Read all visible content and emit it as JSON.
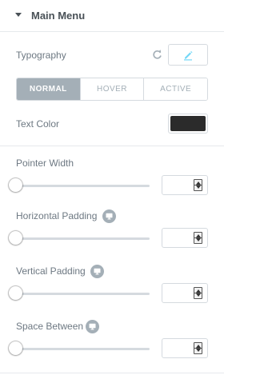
{
  "section": {
    "title": "Main Menu",
    "expanded": true
  },
  "typography": {
    "label": "Typography"
  },
  "tabs": [
    {
      "label": "NORMAL",
      "active": true
    },
    {
      "label": "HOVER",
      "active": false
    },
    {
      "label": "ACTIVE",
      "active": false
    }
  ],
  "text_color": {
    "label": "Text Color",
    "value": "#2b2b2b"
  },
  "controls": [
    {
      "label": "Pointer Width",
      "responsive": false,
      "value": "",
      "level": 0
    },
    {
      "label": "Horizontal Padding",
      "responsive": true,
      "value": "",
      "level": 0
    },
    {
      "label": "Vertical Padding",
      "responsive": true,
      "value": "",
      "level": 0
    },
    {
      "label": "Space Between",
      "responsive": true,
      "value": "",
      "level": 0
    }
  ],
  "colors": {
    "accent": "#71d7f7",
    "tab_active_bg": "#a4afb7",
    "border": "#d5dadf",
    "text": "#6d7882",
    "heading": "#495157"
  }
}
